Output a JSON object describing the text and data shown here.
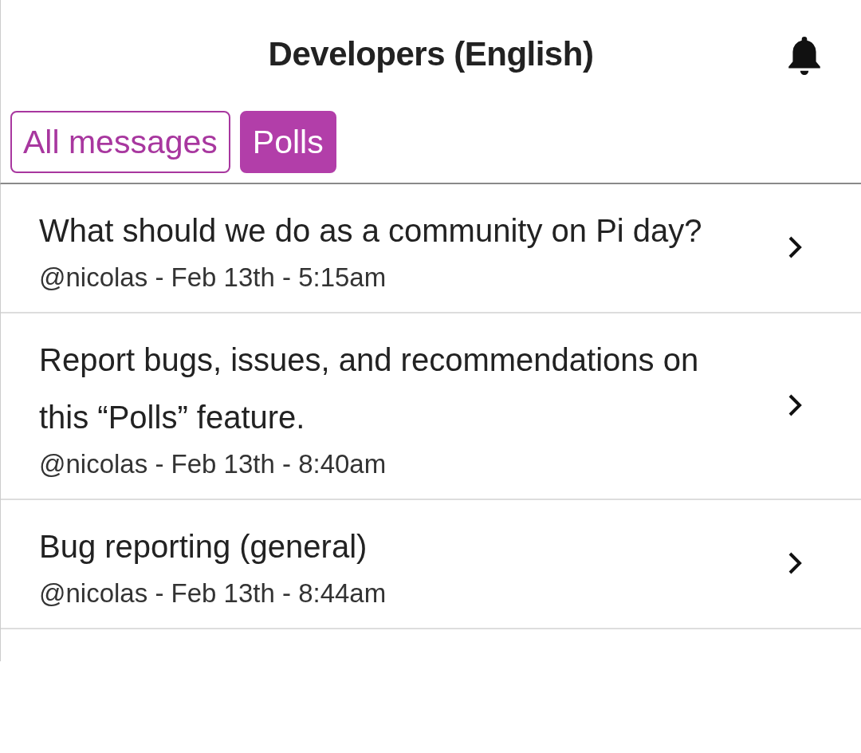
{
  "header": {
    "title": "Developers (English)"
  },
  "tabs": [
    {
      "label": "All messages",
      "selected": false
    },
    {
      "label": "Polls",
      "selected": true
    }
  ],
  "polls": [
    {
      "title": "What should we do as a community on Pi day?",
      "meta": "@nicolas - Feb 13th - 5:15am"
    },
    {
      "title": "Report bugs, issues, and recommendations on this “Polls” feature.",
      "meta": "@nicolas - Feb 13th - 8:40am"
    },
    {
      "title": "Bug reporting (general)",
      "meta": "@nicolas - Feb 13th - 8:44am"
    }
  ]
}
